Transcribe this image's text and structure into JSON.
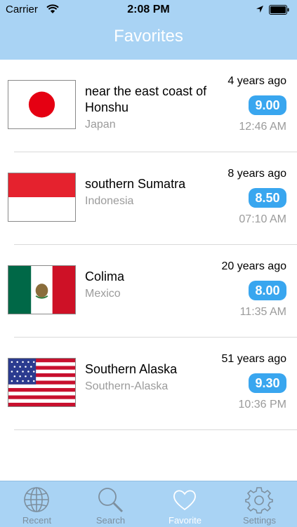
{
  "status_bar": {
    "carrier": "Carrier",
    "time": "2:08 PM"
  },
  "nav": {
    "title": "Favorites"
  },
  "favorites": [
    {
      "place": "near the east coast of Honshu",
      "country": "Japan",
      "flag": "japan-flag",
      "ago": "4 years ago",
      "magnitude": "9.00",
      "time": "12:46 AM"
    },
    {
      "place": "southern Sumatra",
      "country": "Indonesia",
      "flag": "indonesia-flag",
      "ago": "8 years ago",
      "magnitude": "8.50",
      "time": "07:10 AM"
    },
    {
      "place": "Colima",
      "country": "Mexico",
      "flag": "mexico-flag",
      "ago": "20 years ago",
      "magnitude": "8.00",
      "time": "11:35 AM"
    },
    {
      "place": "Southern Alaska",
      "country": "Southern-Alaska",
      "flag": "usa-flag",
      "ago": "51 years ago",
      "magnitude": "9.30",
      "time": "10:36 PM"
    }
  ],
  "tabs": [
    {
      "label": "Recent",
      "icon": "globe-icon"
    },
    {
      "label": "Search",
      "icon": "magnifier-icon"
    },
    {
      "label": "Favorite",
      "icon": "heart-icon",
      "active": true
    },
    {
      "label": "Settings",
      "icon": "gear-icon"
    }
  ],
  "colors": {
    "header": "#a9d3f4",
    "badge": "#39a6ef",
    "muted": "#9b9b9b"
  }
}
